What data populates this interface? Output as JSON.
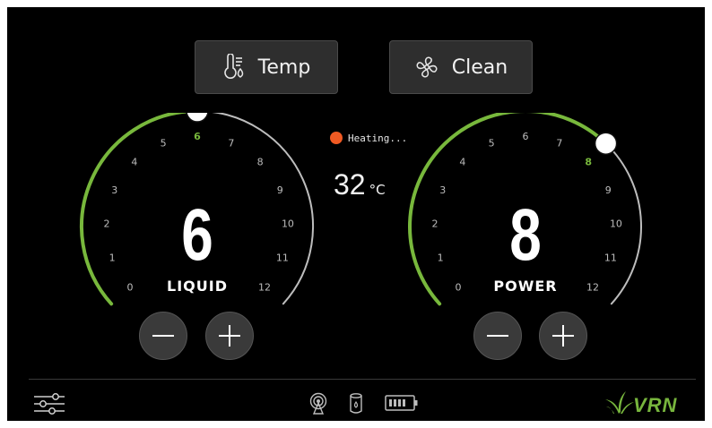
{
  "buttons": {
    "temp_label": "Temp",
    "clean_label": "Clean",
    "temp_icon": "thermometer-drop-icon",
    "clean_icon": "fan-icon"
  },
  "status": {
    "text": "Heating...",
    "dot_color": "#f05a23",
    "temperature": "32",
    "unit": "°C"
  },
  "liquid": {
    "label": "LIQUID",
    "value": "6",
    "level": 6,
    "min": 0,
    "max": 12,
    "scale": [
      "0",
      "1",
      "2",
      "3",
      "4",
      "5",
      "6",
      "7",
      "8",
      "9",
      "10",
      "11",
      "12"
    ]
  },
  "power": {
    "label": "POWER",
    "value": "8",
    "level": 8,
    "min": 0,
    "max": 12,
    "scale": [
      "0",
      "1",
      "2",
      "3",
      "4",
      "5",
      "6",
      "7",
      "8",
      "9",
      "10",
      "11",
      "12"
    ]
  },
  "footer": {
    "settings_icon": "sliders-icon",
    "wifi_icon": "wireless-signal-icon",
    "tank_icon": "water-tank-icon",
    "battery_icon": "battery-icon",
    "logo_text": "VRN"
  },
  "colors": {
    "accent": "#78b83c",
    "track": "#bdbdbd",
    "background": "#000000"
  }
}
